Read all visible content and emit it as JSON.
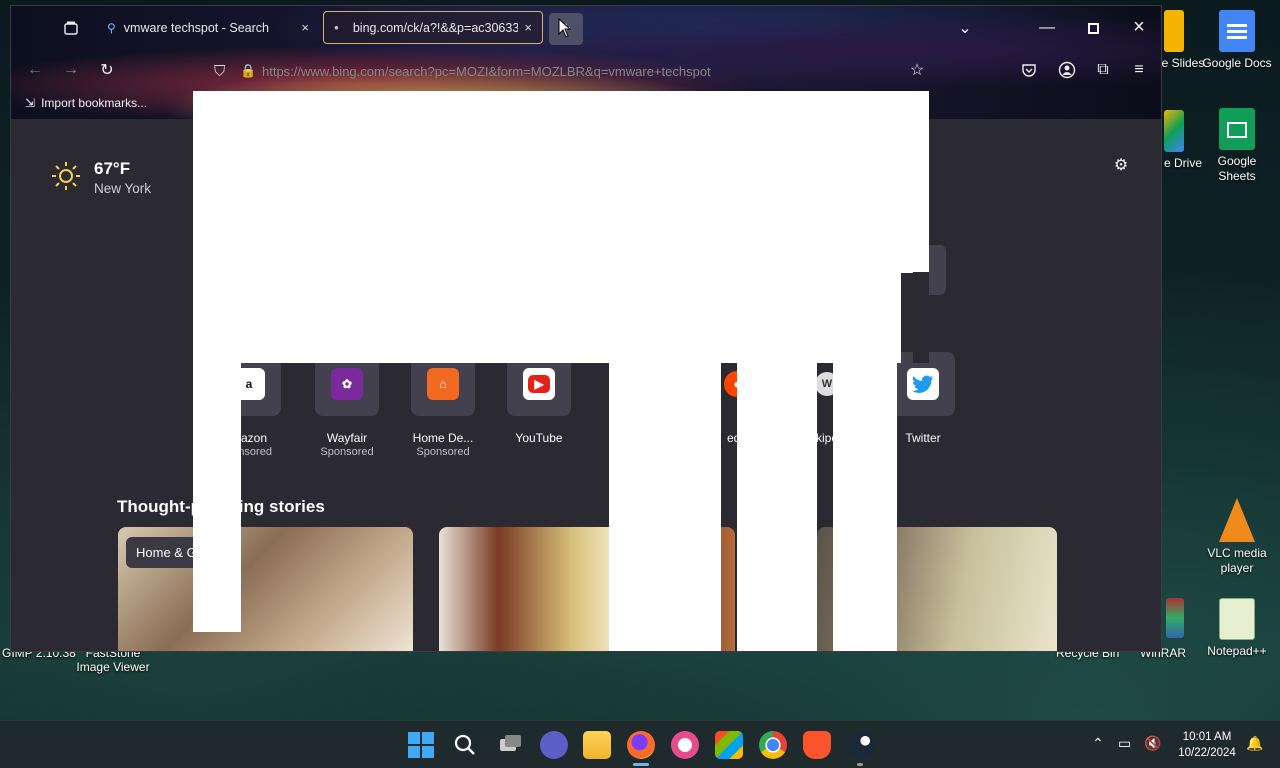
{
  "desktop": {
    "icons_right": [
      {
        "label": "e Slides",
        "name": "google-slides-desktop-icon"
      },
      {
        "label": "Google Docs",
        "name": "google-docs-desktop-icon"
      },
      {
        "label": "e Drive",
        "name": "google-drive-desktop-icon"
      },
      {
        "label": "Google Sheets",
        "name": "google-sheets-desktop-icon"
      },
      {
        "label": "VLC media player",
        "name": "vlc-desktop-icon"
      },
      {
        "label": "Notepad++",
        "name": "notepadpp-desktop-icon"
      }
    ],
    "bottom_labels": {
      "gimp": "GIMP 2.10.38",
      "faststone": "FastStone Image Viewer",
      "recycle": "Recycle Bin",
      "winrar": "WinRAR"
    }
  },
  "browser": {
    "tabs": [
      {
        "label": "vmware techspot - Search",
        "close": "×"
      },
      {
        "label": "bing.com/ck/a?!&&p=ac30633",
        "close": "×"
      }
    ],
    "url": "https://www.bing.com/search?pc=MOZI&form=MOZLBR&q=vmware+techspot",
    "bookmarks_label": "Import bookmarks...",
    "weather": {
      "temp": "67°F",
      "location": "New York"
    },
    "shortcuts": [
      {
        "label": "mazon",
        "sub": "ponsored",
        "logo": "a"
      },
      {
        "label": "Wayfair",
        "sub": "Sponsored",
        "logo": "✿"
      },
      {
        "label": "Home De...",
        "sub": "Sponsored",
        "logo": "⌂"
      },
      {
        "label": "YouTube",
        "sub": "",
        "logo": "▶"
      },
      {
        "label": "edd",
        "sub": "",
        "logo": "●"
      },
      {
        "label": "kipe",
        "sub": "",
        "logo": "W"
      },
      {
        "label": "Twitter",
        "sub": "",
        "logo": "🐦"
      }
    ],
    "stories_title": "Thought-p      king stories",
    "card_badge": "Home & G"
  },
  "taskbar": {
    "time": "10:01 AM",
    "date": "10/22/2024"
  }
}
